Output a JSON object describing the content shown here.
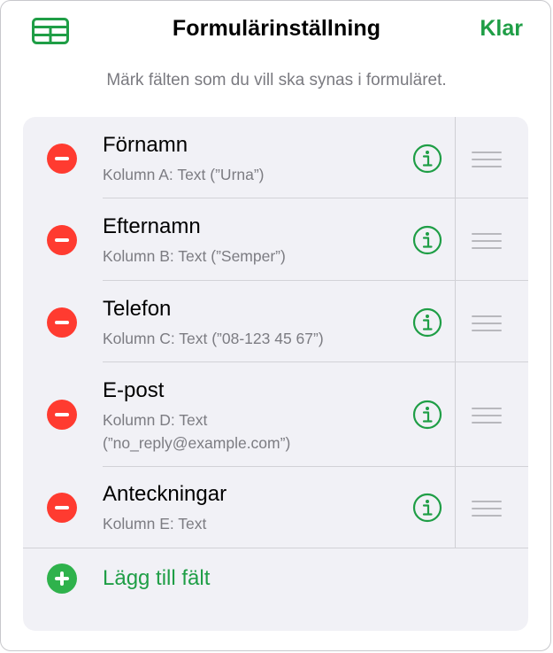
{
  "header": {
    "title": "Formulärinställning",
    "done_label": "Klar",
    "table_icon": "table-grid-icon"
  },
  "instructions": "Märk fälten som du vill ska synas i formuläret.",
  "colors": {
    "accent": "#1f9e46",
    "remove": "#ff3b30",
    "add": "#2fb24c"
  },
  "fields": [
    {
      "name": "Förnamn",
      "desc": "Kolumn A: Text (”Urna”)"
    },
    {
      "name": "Efternamn",
      "desc": "Kolumn B: Text (”Semper”)"
    },
    {
      "name": "Telefon",
      "desc": "Kolumn C: Text (”08-123 45 67”)"
    },
    {
      "name": "E-post",
      "desc": "Kolumn D: Text (”no_reply@example.com”)"
    },
    {
      "name": "Anteckningar",
      "desc": "Kolumn E: Text"
    }
  ],
  "add_field_label": "Lägg till fält"
}
